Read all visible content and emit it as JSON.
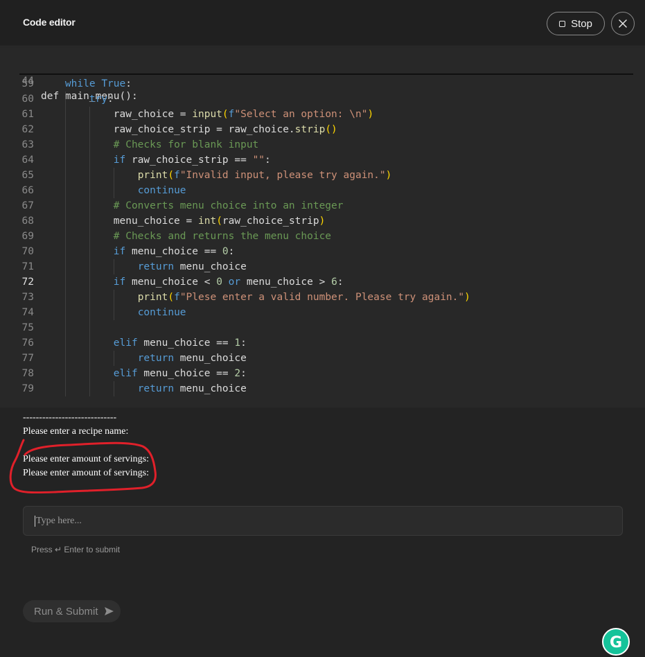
{
  "header": {
    "title": "Code editor",
    "stop_label": "Stop",
    "close_icon": "close-icon",
    "stop_icon": "stop-square-icon"
  },
  "editor": {
    "sticky": {
      "line_number": "44",
      "code": "def main_menu():"
    },
    "active_line": "72",
    "lines": [
      {
        "n": "59",
        "code": "    while True:"
      },
      {
        "n": "60",
        "code": "        try:"
      },
      {
        "n": "61",
        "code": "            raw_choice = input(f\"Select an option: \\n\")"
      },
      {
        "n": "62",
        "code": "            raw_choice_strip = raw_choice.strip()"
      },
      {
        "n": "63",
        "code": "            # Checks for blank input"
      },
      {
        "n": "64",
        "code": "            if raw_choice_strip == \"\":"
      },
      {
        "n": "65",
        "code": "                print(f\"Invalid input, please try again.\")"
      },
      {
        "n": "66",
        "code": "                continue"
      },
      {
        "n": "67",
        "code": "            # Converts menu choice into an integer"
      },
      {
        "n": "68",
        "code": "            menu_choice = int(raw_choice_strip)"
      },
      {
        "n": "69",
        "code": "            # Checks and returns the menu choice"
      },
      {
        "n": "70",
        "code": "            if menu_choice == 0:"
      },
      {
        "n": "71",
        "code": "                return menu_choice"
      },
      {
        "n": "72",
        "code": "            if menu_choice < 0 or menu_choice > 6:"
      },
      {
        "n": "73",
        "code": "                print(f\"Plese enter a valid number. Please try again.\")"
      },
      {
        "n": "74",
        "code": "                continue"
      },
      {
        "n": "75",
        "code": ""
      },
      {
        "n": "76",
        "code": "            elif menu_choice == 1:"
      },
      {
        "n": "77",
        "code": "                return menu_choice"
      },
      {
        "n": "78",
        "code": "            elif menu_choice == 2:"
      },
      {
        "n": "79",
        "code": "                return menu_choice"
      }
    ]
  },
  "console": {
    "lines": [
      "-----------------------------",
      "Please enter a recipe name:",
      "Please enter amount of servings:",
      "Please enter amount of servings:"
    ]
  },
  "input": {
    "placeholder": "Type here...",
    "hint": "Press ↵ Enter to submit"
  },
  "run": {
    "label": "Run & Submit",
    "icon": "send-icon"
  },
  "grammarly": {
    "icon": "grammarly-icon",
    "letter": "G"
  },
  "colors": {
    "keyword": "#569cd6",
    "function": "#dcdcaa",
    "string": "#ce9178",
    "comment": "#6a9955",
    "number": "#b5cea8",
    "bracket": "#ffd700",
    "annotation": "#e0202a",
    "grammarly": "#15c39a"
  }
}
